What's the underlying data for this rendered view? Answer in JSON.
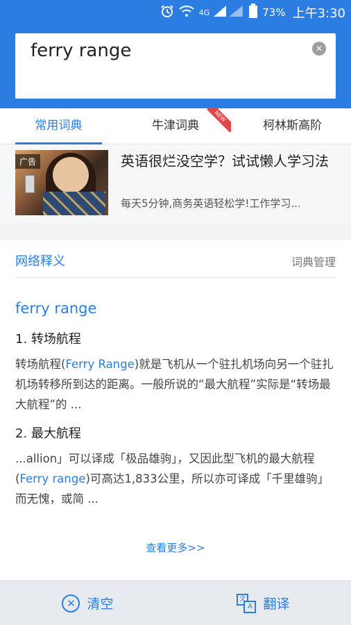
{
  "status_bar": {
    "alarm_icon": "alarm-icon",
    "wifi_icon": "wifi-icon",
    "network": "4G",
    "battery_percent": "73%",
    "time": "上午3:30"
  },
  "search": {
    "query": "ferry range",
    "clear_icon": "clear-icon"
  },
  "tabs": [
    {
      "label": "常用词典",
      "active": true
    },
    {
      "label": "牛津词典",
      "badge": "NEW"
    },
    {
      "label": "柯林斯高阶"
    }
  ],
  "ad": {
    "tag": "广告",
    "title": "英语很烂没空学？试试懒人学习法",
    "desc": "每天5分钟,商务英语轻松学!工作学习..."
  },
  "web_definitions": {
    "section_title": "网络释义",
    "manage_label": "词典管理",
    "term": "ferry range",
    "entries": [
      {
        "title": "1. 转场航程",
        "text_before": "转场航程(",
        "highlight": "Ferry Range",
        "text_after": ")就是飞机从一个驻扎机场向另一个驻扎机场转移所到达的距离。一般所说的“最大航程”实际是“转场最大航程”的 ..."
      },
      {
        "title": "2. 最大航程",
        "text_before": "...allion」可以译成「极品雄驹」，又因此型飞机的最大航程(",
        "highlight": "Ferry range",
        "text_after": ")可高达1,833公里，所以亦可译成「千里雄驹」而无愧，或简 ..."
      }
    ],
    "more_label": "查看更多>>"
  },
  "bottom_bar": {
    "clear_label": "清空",
    "translate_label": "翻译"
  },
  "colors": {
    "accent": "#2b7de2",
    "header_bg": "#2b7de2",
    "badge_red": "#e64545"
  }
}
